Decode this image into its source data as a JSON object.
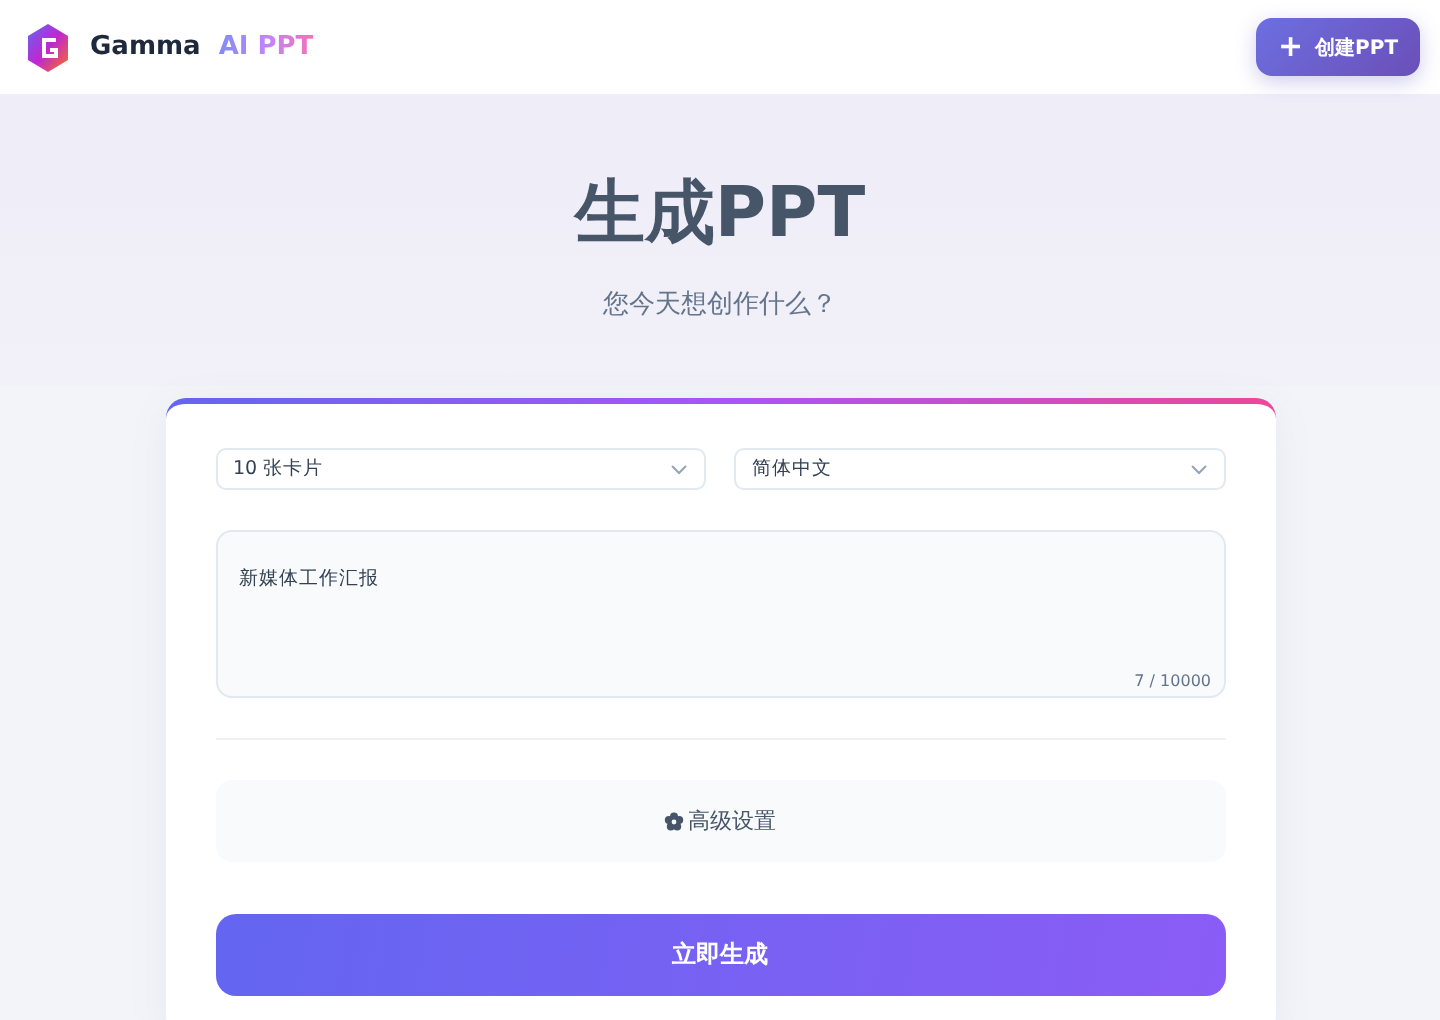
{
  "header": {
    "brand": "Gamma",
    "brand_accent": "AI PPT",
    "create_button": {
      "icon": "+",
      "label": "创建PPT"
    }
  },
  "hero": {
    "title": "生成PPT",
    "subtitle": "您今天想创作什么？"
  },
  "form": {
    "selects": [
      {
        "value": "10 张卡片"
      },
      {
        "value": "简体中文"
      }
    ],
    "prompt": {
      "value": "新媒体工作汇报",
      "counter": "7 / 10000"
    },
    "advanced_button": "高级设置",
    "generate_button": "立即生成"
  }
}
